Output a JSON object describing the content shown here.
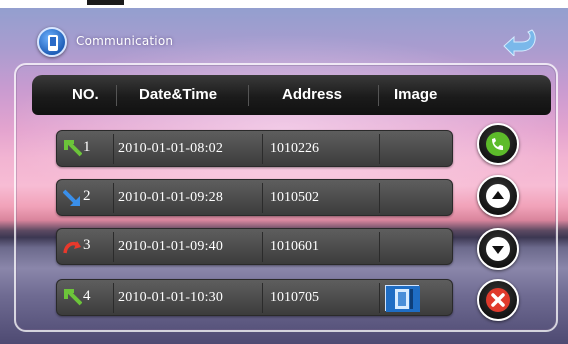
{
  "header": {
    "title": "Communication",
    "icons": {
      "app": "phone-globe-icon",
      "back": "return-arrow-icon"
    }
  },
  "table": {
    "columns": [
      "NO.",
      "Date&Time",
      "Address",
      "Image"
    ],
    "rows": [
      {
        "no": "1",
        "datetime": "2010-01-01-08:02",
        "address": "1010226",
        "direction": "incoming-call-icon",
        "has_image": false
      },
      {
        "no": "2",
        "datetime": "2010-01-01-09:28",
        "address": "1010502",
        "direction": "outgoing-call-icon",
        "has_image": false
      },
      {
        "no": "3",
        "datetime": "2010-01-01-09:40",
        "address": "1010601",
        "direction": "missed-call-icon",
        "has_image": false
      },
      {
        "no": "4",
        "datetime": "2010-01-01-10:30",
        "address": "1010705",
        "direction": "incoming-call-icon",
        "has_image": true
      }
    ]
  },
  "side_buttons": [
    "call-back-icon",
    "scroll-up-icon",
    "scroll-down-icon",
    "delete-icon"
  ],
  "colors": {
    "accent_green": "#5dbb2a",
    "delete_red": "#e03a2c",
    "outgoing_blue": "#2f7fe0",
    "missed_red": "#e8392c"
  }
}
